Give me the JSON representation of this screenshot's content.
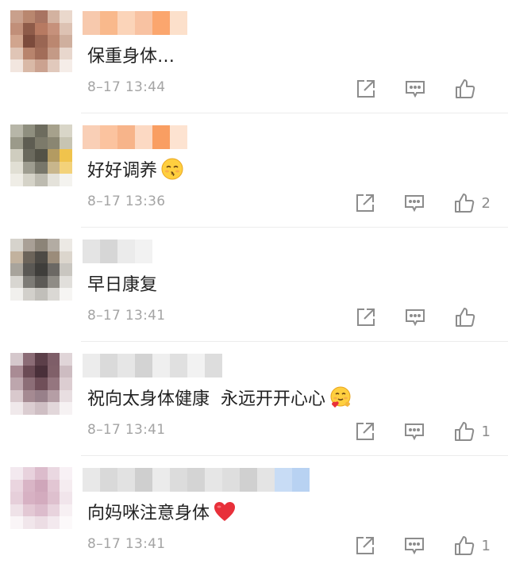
{
  "comments": [
    {
      "text": "保重身体…",
      "time": "8–17 13:44",
      "likes": "",
      "emoji": "",
      "avatar": [
        "#c9a08c",
        "#b9876f",
        "#a87462",
        "#d3b2a0",
        "#ead8cc",
        "#c18f79",
        "#8e5b49",
        "#b77a62",
        "#c6917b",
        "#ddc2b3",
        "#d1a58e",
        "#7c4b3c",
        "#9a6653",
        "#bb8770",
        "#cfaf9e",
        "#e0c5b6",
        "#b8846d",
        "#a26d59",
        "#c49a86",
        "#e8d7cd",
        "#f2e6df",
        "#d9b9a7",
        "#cba290",
        "#e1c9bc",
        "#f5ede8"
      ],
      "name_colors": [
        "#f7c9ad",
        "#f9b98c",
        "#fbd4b9",
        "#f8c2a2",
        "#fba66e",
        "#fce0cb"
      ]
    },
    {
      "text": "好好调养",
      "time": "8–17 13:36",
      "likes": "2",
      "emoji": "kiss-face",
      "avatar": [
        "#b7b6a8",
        "#8f8f7f",
        "#6d6c5e",
        "#a6a18c",
        "#d9d6c8",
        "#9b9a8a",
        "#5e5d52",
        "#7c7a6a",
        "#8a8672",
        "#c7c4b2",
        "#cfcdbf",
        "#6a695d",
        "#535247",
        "#b39b62",
        "#f0c34c",
        "#e1dfd4",
        "#9e9d90",
        "#77766a",
        "#c8b68c",
        "#f3d27a",
        "#efede6",
        "#d5d3c8",
        "#bdbbb0",
        "#e4e2da",
        "#f4f3ef"
      ],
      "name_colors": [
        "#f9cfb6",
        "#fbc39f",
        "#f7b48a",
        "#fcd9c3",
        "#f99e62",
        "#fde3d1"
      ]
    },
    {
      "text": "早日康复",
      "time": "8–17 13:41",
      "likes": "",
      "emoji": "",
      "avatar": [
        "#d6d3cc",
        "#a9a096",
        "#8c8478",
        "#b3aca3",
        "#ece9e4",
        "#c2b29e",
        "#6c645a",
        "#4d4a45",
        "#9b8c7a",
        "#dcd6cd",
        "#a8a49c",
        "#5a5854",
        "#3f3e3b",
        "#6b6864",
        "#c9c6c0",
        "#d8d6d1",
        "#7d7b76",
        "#5c5a56",
        "#8f8c86",
        "#e1dfdb",
        "#f1f0ed",
        "#d2d0cb",
        "#c1bfba",
        "#dad8d4",
        "#f6f5f3"
      ],
      "name_colors": [
        "#e4e4e4",
        "#d6d6d6",
        "#ebebeb",
        "#f2f2f2"
      ]
    },
    {
      "text": "祝向太身体健康  永远开开心心",
      "time": "8–17 13:41",
      "likes": "1",
      "emoji": "hugging-face",
      "avatar": [
        "#d5c8cc",
        "#8b6c76",
        "#5c3f49",
        "#7e5e68",
        "#e0d5d8",
        "#a98b94",
        "#6b4b55",
        "#4a303a",
        "#806069",
        "#cdbcc1",
        "#bda6ad",
        "#8c6e77",
        "#704f59",
        "#95767f",
        "#dccdd1",
        "#d9c9cd",
        "#a58a92",
        "#98808a",
        "#b59ea5",
        "#e8dee1",
        "#f0e9eb",
        "#dbcdd1",
        "#cfbfc4",
        "#e2d7da",
        "#f6f2f3"
      ],
      "name_colors": [
        "#ececec",
        "#dadada",
        "#e6e6e6",
        "#d3d3d3",
        "#efefef",
        "#e0e0e0",
        "#f2f2f2",
        "#dddddd"
      ]
    },
    {
      "text": "向妈咪注意身体",
      "time": "8–17 13:41",
      "likes": "1",
      "emoji": "red-heart",
      "avatar": [
        "#f3e9ef",
        "#e8d2dd",
        "#dcbccc",
        "#ead8e1",
        "#f8f1f5",
        "#ead5df",
        "#d9b5c6",
        "#cfa6ba",
        "#e2c6d3",
        "#f5ecf0",
        "#e6cfda",
        "#d7b1c3",
        "#d3abbe",
        "#dec0ce",
        "#f1e5eb",
        "#efe2e8",
        "#e3c8d4",
        "#dcbccc",
        "#e8d3dd",
        "#f7f0f3",
        "#faf5f7",
        "#f1e6eb",
        "#ecdde4",
        "#f3e9ee",
        "#fcf9fa"
      ],
      "name_colors": [
        "#e8e8e8",
        "#d9d9d9",
        "#e2e2e2",
        "#cfcfcf",
        "#ebebeb",
        "#dcdcdc",
        "#d4d4d4",
        "#e6e6e6",
        "#dedede",
        "#d0d0d0",
        "#e4e4e4",
        "#c8dcf5",
        "#b8d2f2"
      ]
    }
  ],
  "colors": {
    "meta": "#a4a4a4",
    "icon": "#8c8c8c",
    "heart": "#e8303a",
    "divider": "#ececec"
  }
}
